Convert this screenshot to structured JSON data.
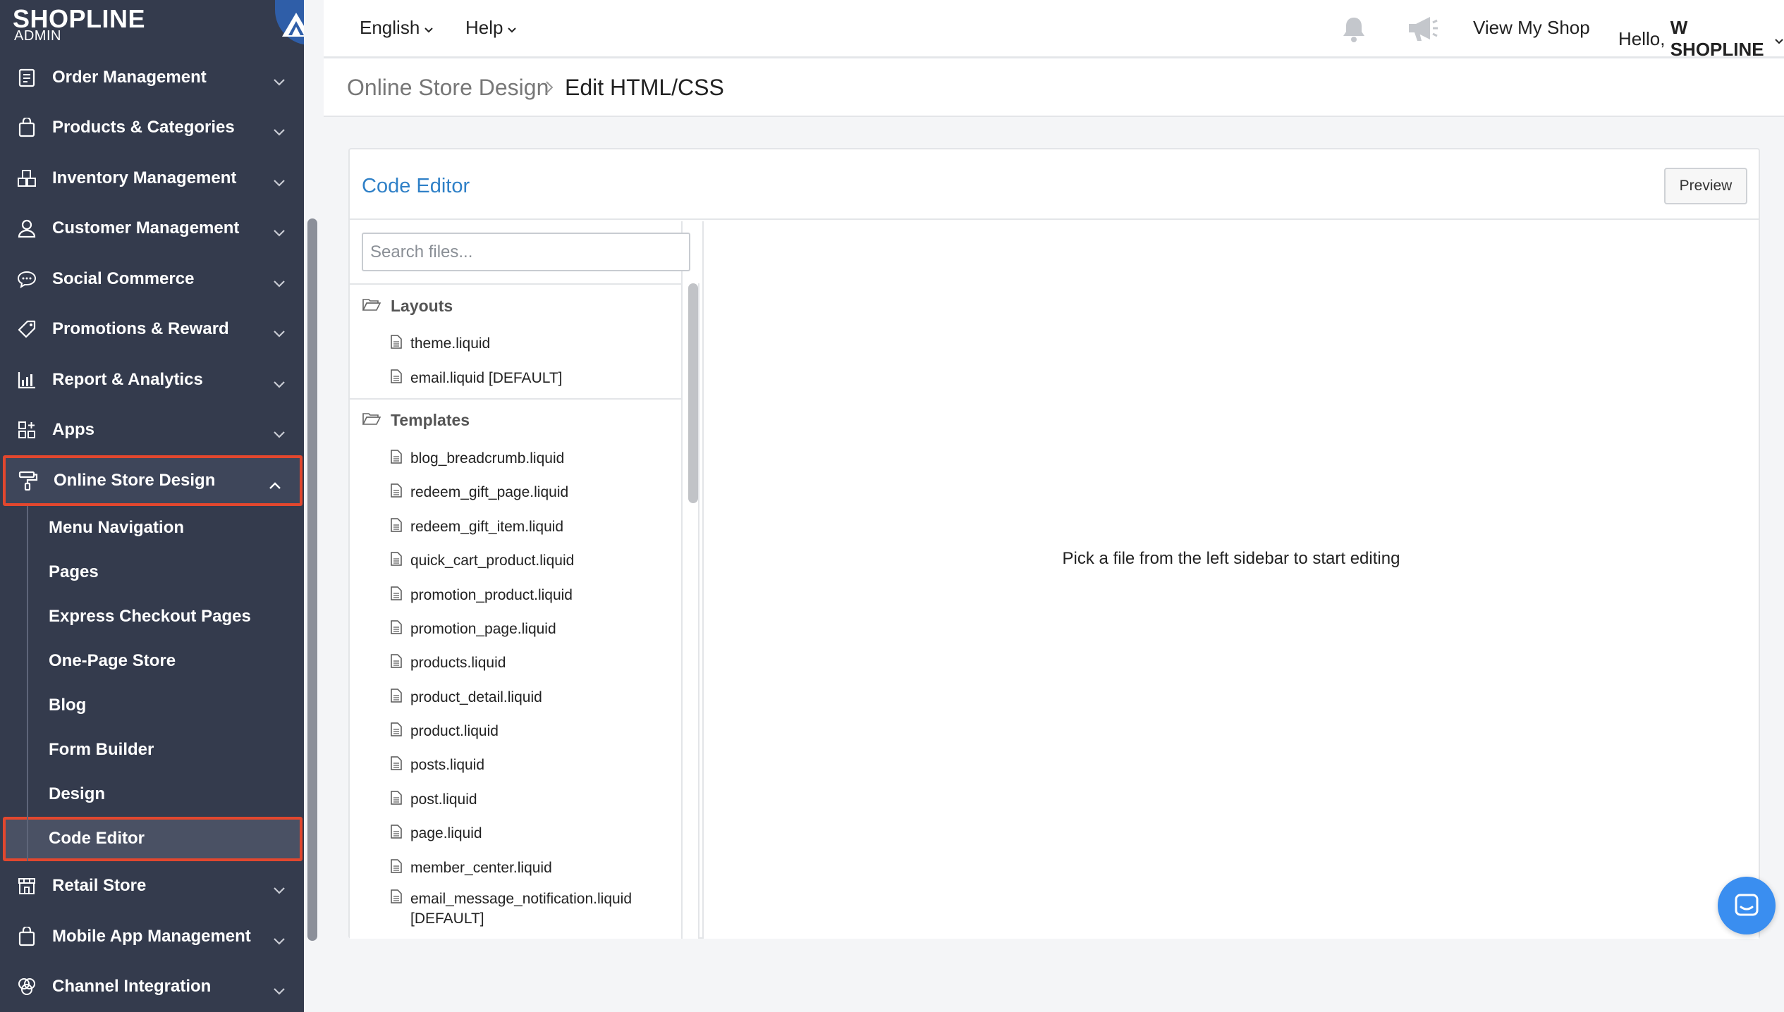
{
  "brand": {
    "name": "SHOPLINE",
    "sub": "ADMIN"
  },
  "sidebar": {
    "items": [
      {
        "label": "Order Management",
        "icon": "clipboard-icon"
      },
      {
        "label": "Products & Categories",
        "icon": "bag-icon"
      },
      {
        "label": "Inventory Management",
        "icon": "boxes-icon"
      },
      {
        "label": "Customer Management",
        "icon": "user-icon"
      },
      {
        "label": "Social Commerce",
        "icon": "chat-bubble-icon"
      },
      {
        "label": "Promotions & Reward",
        "icon": "tag-icon"
      },
      {
        "label": "Report & Analytics",
        "icon": "chart-icon"
      },
      {
        "label": "Apps",
        "icon": "apps-icon"
      }
    ],
    "active_section": {
      "label": "Online Store Design",
      "icon": "paint-roller-icon"
    },
    "sub_items": [
      {
        "label": "Menu Navigation"
      },
      {
        "label": "Pages"
      },
      {
        "label": "Express Checkout Pages"
      },
      {
        "label": "One-Page Store"
      },
      {
        "label": "Blog"
      },
      {
        "label": "Form Builder"
      },
      {
        "label": "Design"
      },
      {
        "label": "Code Editor"
      }
    ],
    "items_after": [
      {
        "label": "Retail Store",
        "icon": "store-icon"
      },
      {
        "label": "Mobile App Management",
        "icon": "mobile-bag-icon"
      },
      {
        "label": "Channel Integration",
        "icon": "circles-icon"
      }
    ]
  },
  "topbar": {
    "language": "English",
    "help": "Help",
    "view_shop": "View My Shop",
    "greeting_prefix": "Hello, ",
    "greeting_name": "W SHOPLINE"
  },
  "breadcrumb": {
    "parent": "Online Store Design",
    "current": "Edit HTML/CSS"
  },
  "editor": {
    "title": "Code Editor",
    "preview_label": "Preview",
    "search_placeholder": "Search files...",
    "empty_message": "Pick a file from the left sidebar to start editing",
    "groups": [
      {
        "name": "Layouts",
        "files": [
          "theme.liquid",
          "email.liquid [DEFAULT]"
        ]
      },
      {
        "name": "Templates",
        "files": [
          "blog_breadcrumb.liquid",
          "redeem_gift_page.liquid",
          "redeem_gift_item.liquid",
          "quick_cart_product.liquid",
          "promotion_product.liquid",
          "promotion_page.liquid",
          "products.liquid",
          "product_detail.liquid",
          "product.liquid",
          "posts.liquid",
          "post.liquid",
          "page.liquid",
          "member_center.liquid",
          "email_message_notification.liquid [DEFAULT]"
        ]
      }
    ]
  },
  "colors": {
    "sidebar_bg": "#343b4d",
    "highlight": "#e2472e",
    "accent": "#2f80c7",
    "chat_button": "#3a8ef0"
  }
}
